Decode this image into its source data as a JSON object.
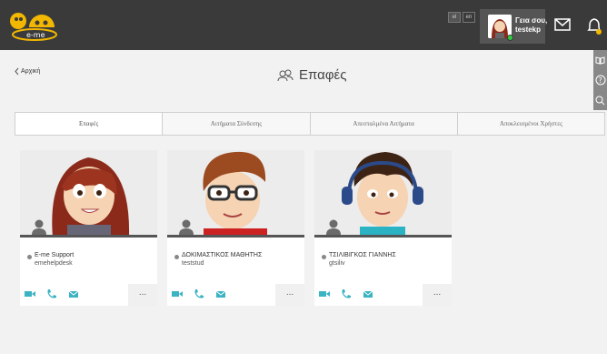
{
  "header": {
    "languages": [
      "el",
      "en"
    ],
    "greeting": "Γεια σου,",
    "username": "testekp",
    "colors": {
      "bar": "#3a3a3a",
      "accent": "#f2b700",
      "online": "#2ecc40"
    },
    "icons": [
      "e-me-logo",
      "mail-icon",
      "bell-icon"
    ]
  },
  "side_tools": [
    "book-icon",
    "help-icon",
    "search-icon"
  ],
  "nav": {
    "back_label": "Αρχική"
  },
  "page": {
    "title": "Επαφές",
    "icon": "contacts-icon"
  },
  "tabs": [
    {
      "label": "Επαφές",
      "active": true
    },
    {
      "label": "Αιτήματα Σύνδεσης",
      "active": false
    },
    {
      "label": "Απεσταλμένα Αιτήματα",
      "active": false
    },
    {
      "label": "Αποκλεισμένοι Χρήστες",
      "active": false
    }
  ],
  "contacts": [
    {
      "name": "E-me Support",
      "username": "emehelpdesk"
    },
    {
      "name": "ΔΟΚΙΜΑΣΤΙΚΟΣ ΜΑΘΗΤΗΣ",
      "username": "teststud"
    },
    {
      "name": "ΤΣΙΛΙΒΙΓΚΟΣ ΓΙΑΝΝΗΣ",
      "username": "gtsiliv"
    }
  ],
  "card_actions": {
    "more_label": "...",
    "icons": [
      "video-icon",
      "phone-icon",
      "message-icon"
    ]
  }
}
